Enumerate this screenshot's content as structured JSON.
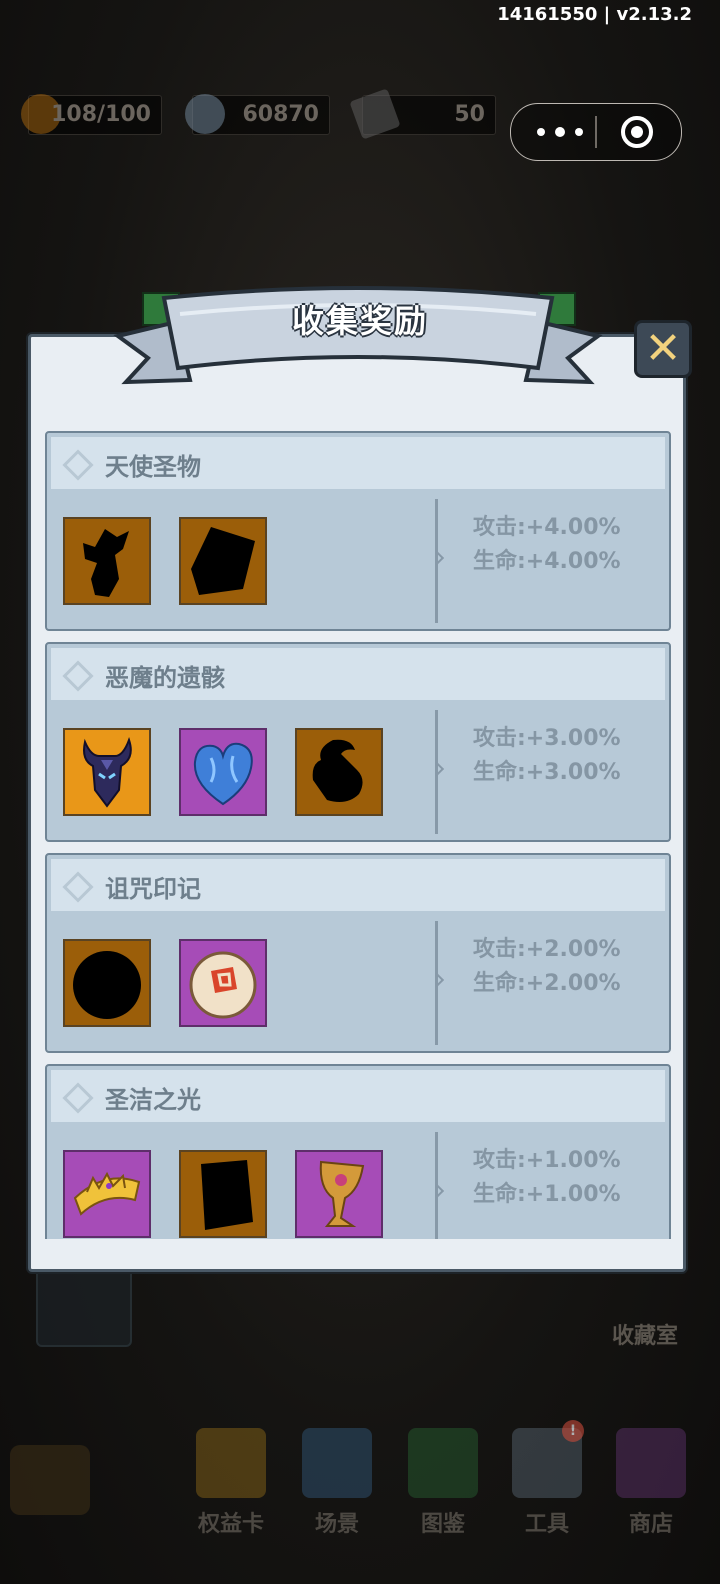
{
  "build": "14161550 | v2.13.2",
  "resources": [
    {
      "icon": "bread-icon",
      "value": "108/100",
      "color": "#a0620f"
    },
    {
      "icon": "coin-icon",
      "value": "60870",
      "color": "#6f8495"
    },
    {
      "icon": "ingot-icon",
      "value": "50",
      "color": "#5c5c5c"
    }
  ],
  "modal": {
    "title": "收集奖励",
    "sections": [
      {
        "name": "天使圣物",
        "stats": [
          "攻击:+4.00%",
          "生命:+4.00%"
        ],
        "items": [
          {
            "icon": "angel-statue-silhouette-icon",
            "rarity": "brown",
            "locked": true
          },
          {
            "icon": "tome-silhouette-icon",
            "rarity": "brown",
            "locked": true
          }
        ]
      },
      {
        "name": "恶魔的遗骸",
        "stats": [
          "攻击:+3.00%",
          "生命:+3.00%"
        ],
        "items": [
          {
            "icon": "demon-helmet-icon",
            "rarity": "orange",
            "locked": false
          },
          {
            "icon": "blue-heart-icon",
            "rarity": "purple",
            "locked": false
          },
          {
            "icon": "claw-silhouette-icon",
            "rarity": "brown",
            "locked": true
          }
        ]
      },
      {
        "name": "诅咒印记",
        "stats": [
          "攻击:+2.00%",
          "生命:+2.00%"
        ],
        "items": [
          {
            "icon": "orb-silhouette-icon",
            "rarity": "brown",
            "locked": true
          },
          {
            "icon": "cursed-seal-icon",
            "rarity": "purple",
            "locked": false
          }
        ]
      },
      {
        "name": "圣洁之光",
        "stats": [
          "攻击:+1.00%",
          "生命:+1.00%"
        ],
        "items": [
          {
            "icon": "golden-crown-icon",
            "rarity": "purple",
            "locked": false
          },
          {
            "icon": "book-silhouette-icon",
            "rarity": "brown",
            "locked": true
          },
          {
            "icon": "holy-chalice-icon",
            "rarity": "purple",
            "locked": false
          }
        ]
      }
    ]
  },
  "collection_room": "收藏室",
  "nav": [
    {
      "label": "权益卡",
      "icon": "privilege-card-icon",
      "badge": ""
    },
    {
      "label": "场景",
      "icon": "scene-house-icon",
      "badge": ""
    },
    {
      "label": "图鉴",
      "icon": "codex-book-icon",
      "badge": ""
    },
    {
      "label": "工具",
      "icon": "hammer-tool-icon",
      "badge": "!"
    },
    {
      "label": "商店",
      "icon": "shop-crystal-icon",
      "badge": ""
    }
  ]
}
